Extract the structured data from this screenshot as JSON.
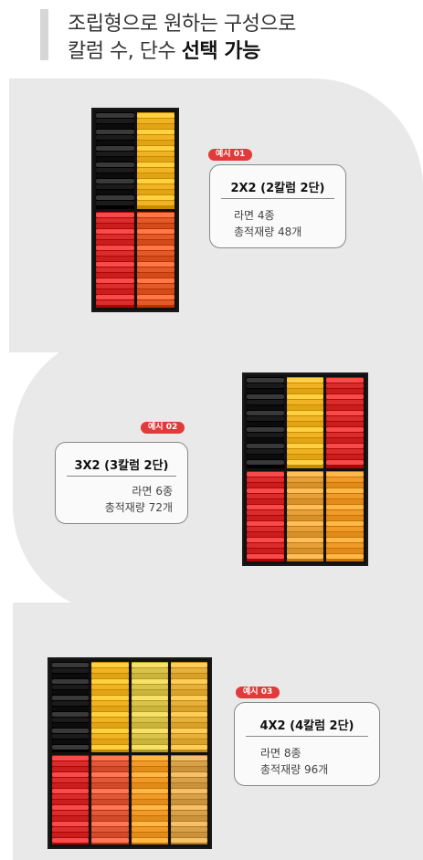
{
  "header": {
    "line1": "조립형으로 원하는 구성으로",
    "line2_prefix": "칼럼 수, 단수 ",
    "line2_bold": "선택 가능"
  },
  "examples": [
    {
      "badge": "예시 01",
      "title": "2X2 (2칼럼 2단)",
      "line1": "라면 4종",
      "line2": "총적재량 48개"
    },
    {
      "badge": "예시 02",
      "title": "3X2 (3칼럼 2단)",
      "line1": "라면 6종",
      "line2": "총적재량 72개"
    },
    {
      "badge": "예시 03",
      "title": "4X2 (4칼럼 2단)",
      "line1": "라면 8종",
      "line2": "총적재량 96개"
    }
  ],
  "colors": {
    "background": "#e9e9e9",
    "badge": "#e03a3a",
    "card_border": "#888888",
    "rack": "#111111"
  },
  "racks": [
    {
      "columns": 2,
      "rows": 2,
      "palette": [
        [
          "#1b1b1b",
          "#f0b323"
        ],
        [
          "#d92d2d",
          "#e35a2a"
        ]
      ]
    },
    {
      "columns": 3,
      "rows": 2,
      "palette": [
        [
          "#1b1b1b",
          "#f0b323",
          "#d92d2d"
        ],
        [
          "#d92d2d",
          "#e6a03a",
          "#f09a2a"
        ]
      ]
    },
    {
      "columns": 4,
      "rows": 2,
      "palette": [
        [
          "#1b1b1b",
          "#f0b323",
          "#d9c34a",
          "#e6b03a"
        ],
        [
          "#d92d2d",
          "#e05a3a",
          "#f09a2a",
          "#d9a24a"
        ]
      ]
    }
  ]
}
